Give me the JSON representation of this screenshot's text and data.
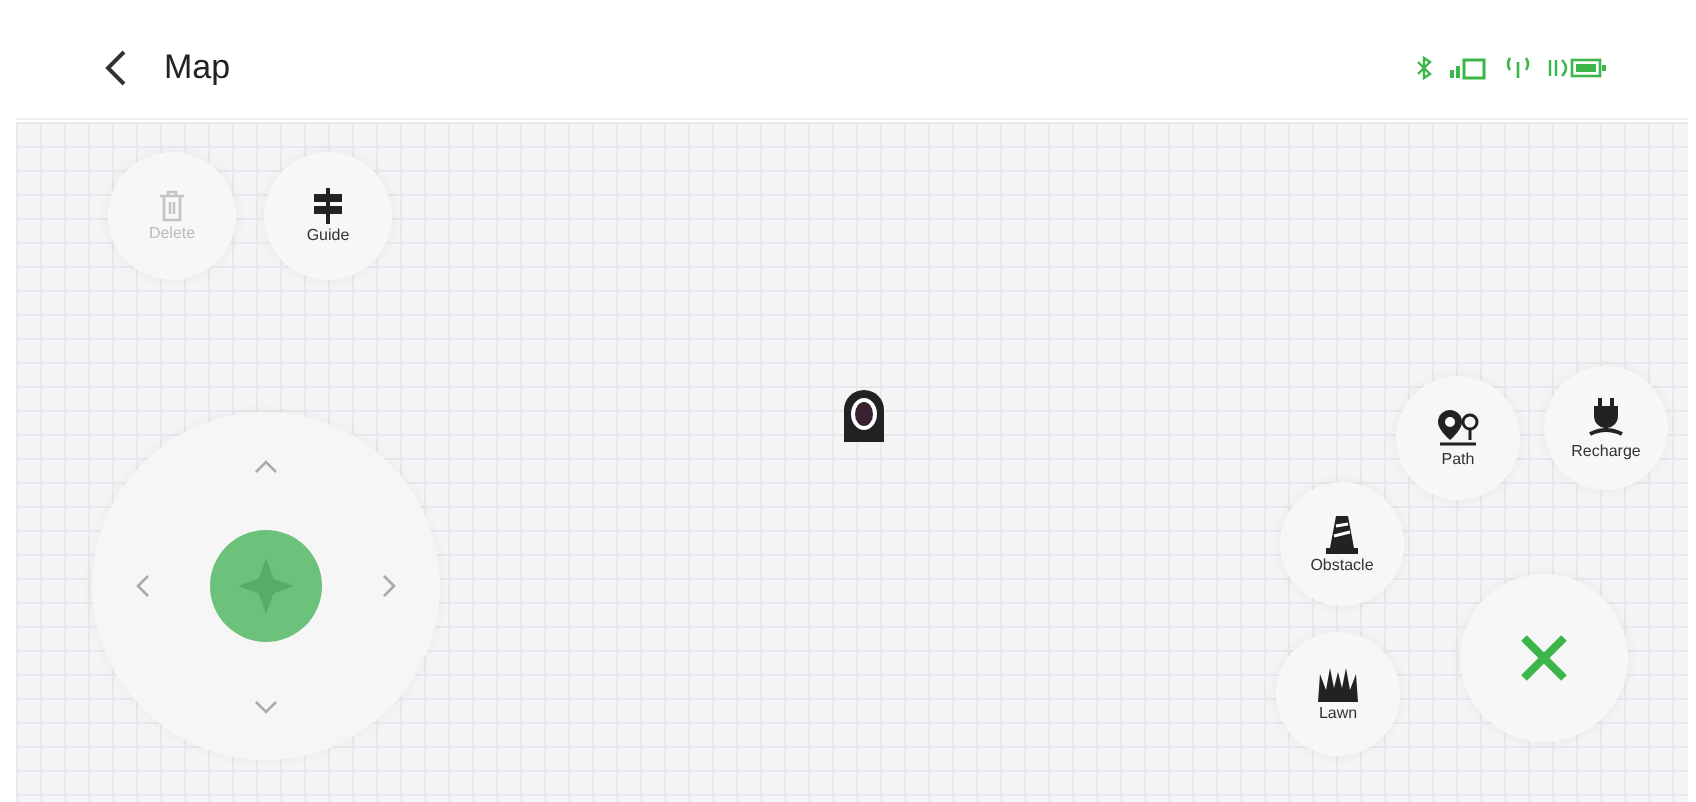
{
  "header": {
    "title": "Map"
  },
  "tools": [
    {
      "kind": "delete",
      "label": "Delete",
      "disabled": true
    },
    {
      "kind": "guide",
      "label": "Guide",
      "disabled": false
    }
  ],
  "actions": [
    {
      "kind": "path",
      "label": "Path"
    },
    {
      "kind": "recharge",
      "label": "Recharge"
    },
    {
      "kind": "obstacle",
      "label": "Obstacle"
    },
    {
      "kind": "lawn",
      "label": "Lawn"
    }
  ]
}
